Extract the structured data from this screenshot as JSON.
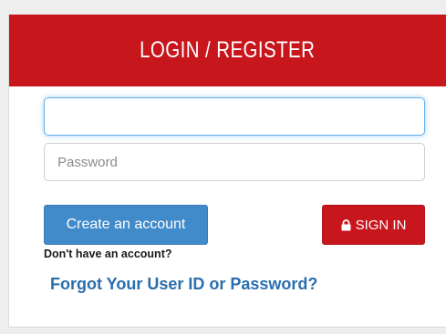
{
  "header": {
    "title": "LOGIN / REGISTER"
  },
  "form": {
    "user_id": {
      "value": "",
      "placeholder": ""
    },
    "password": {
      "value": "",
      "placeholder": "Password"
    }
  },
  "buttons": {
    "create_account_label": "Create an account",
    "sign_in_label": "SIGN IN",
    "sign_in_icon": "lock-icon"
  },
  "helper": {
    "no_account_text": "Don't have an account?",
    "forgot_link_text": "Forgot Your User ID or Password?"
  },
  "colors": {
    "brand_red": "#c8161d",
    "primary_blue": "#428bca",
    "link_blue": "#2a6fad"
  }
}
